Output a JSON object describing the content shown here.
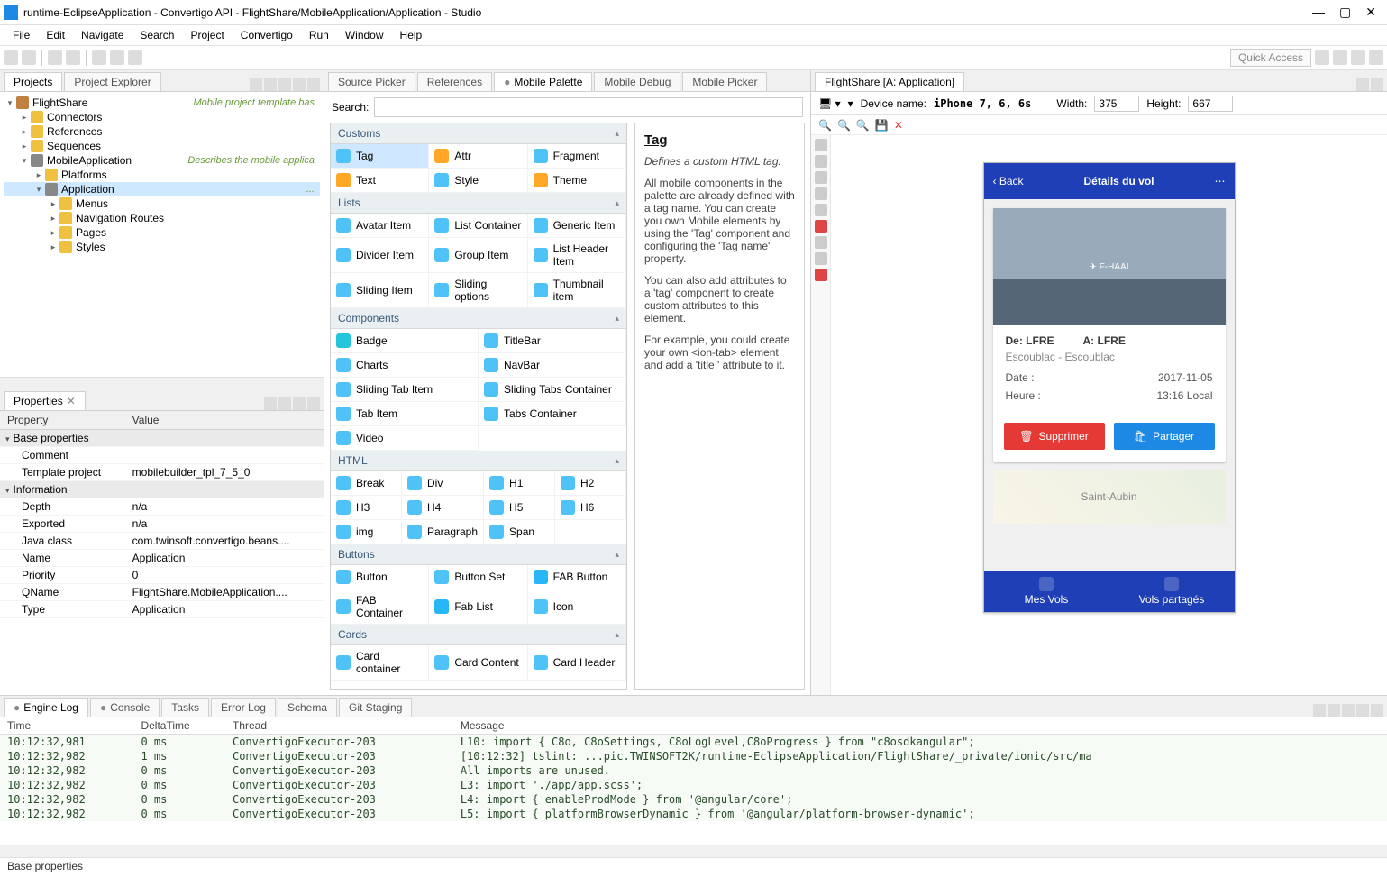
{
  "window": {
    "title": "runtime-EclipseApplication - Convertigo API - FlightShare/MobileApplication/Application - Studio"
  },
  "menubar": [
    "File",
    "Edit",
    "Navigate",
    "Search",
    "Project",
    "Convertigo",
    "Run",
    "Window",
    "Help"
  ],
  "quick_access": "Quick Access",
  "left": {
    "tabs": {
      "projects": "Projects",
      "explorer": "Project Explorer"
    },
    "tree": {
      "root": {
        "label": "FlightShare",
        "desc": "Mobile project template bas"
      },
      "connectors": "Connectors",
      "references": "References",
      "sequences": "Sequences",
      "mobileapp": {
        "label": "MobileApplication",
        "desc": "Describes the mobile applica"
      },
      "platforms": "Platforms",
      "application": "Application",
      "menus": "Menus",
      "navroutes": "Navigation Routes",
      "pages": "Pages",
      "styles": "Styles",
      "app_dots": "..."
    },
    "props": {
      "tab": "Properties",
      "cols": {
        "prop": "Property",
        "val": "Value"
      },
      "cat1": "Base properties",
      "comment": {
        "k": "Comment",
        "v": ""
      },
      "template": {
        "k": "Template project",
        "v": "mobilebuilder_tpl_7_5_0"
      },
      "cat2": "Information",
      "depth": {
        "k": "Depth",
        "v": "n/a"
      },
      "exported": {
        "k": "Exported",
        "v": "n/a"
      },
      "javaclass": {
        "k": "Java class",
        "v": "com.twinsoft.convertigo.beans...."
      },
      "name": {
        "k": "Name",
        "v": "Application"
      },
      "priority": {
        "k": "Priority",
        "v": "0"
      },
      "qname": {
        "k": "QName",
        "v": "FlightShare.MobileApplication...."
      },
      "type": {
        "k": "Type",
        "v": "Application"
      }
    }
  },
  "center": {
    "tabs": {
      "source": "Source Picker",
      "refs": "References",
      "palette": "Mobile Palette",
      "debug": "Mobile Debug",
      "picker": "Mobile Picker"
    },
    "search_label": "Search:",
    "groups": {
      "customs": {
        "hdr": "Customs",
        "items": [
          "Tag",
          "Attr",
          "Fragment",
          "Text",
          "Style",
          "Theme"
        ]
      },
      "lists": {
        "hdr": "Lists",
        "items": [
          "Avatar Item",
          "List Container",
          "Generic Item",
          "Divider Item",
          "Group Item",
          "List Header Item",
          "Sliding Item",
          "Sliding options",
          "Thumbnail item"
        ]
      },
      "components": {
        "hdr": "Components",
        "items": [
          "Badge",
          "TitleBar",
          "Charts",
          "NavBar",
          "Sliding Tab Item",
          "Sliding Tabs Container",
          "Tab Item",
          "Tabs Container",
          "Video"
        ]
      },
      "html": {
        "hdr": "HTML",
        "items": [
          "Break",
          "Div",
          "H1",
          "H2",
          "H3",
          "H4",
          "H5",
          "H6",
          "img",
          "Paragraph",
          "Span"
        ]
      },
      "buttons": {
        "hdr": "Buttons",
        "items": [
          "Button",
          "Button Set",
          "FAB Button",
          "FAB Container",
          "Fab List",
          "Icon"
        ]
      },
      "cards": {
        "hdr": "Cards",
        "items": [
          "Card container",
          "Card Content",
          "Card Header"
        ]
      }
    },
    "desc": {
      "title": "Tag",
      "p1": "Defines a custom HTML tag.",
      "p2": "All mobile components in the palette are already defined with a tag name. You can create you own Mobile elements by using the 'Tag' component and configuring the 'Tag name' property.",
      "p3": "You can also add attributes to a 'tag' component to create custom attributes to this element.",
      "p4": "For example, you could create your own <ion-tab> element and add a 'title ' attribute to it."
    }
  },
  "right": {
    "tab": "FlightShare [A: Application]",
    "devname_label": "Device name:",
    "devname": "iPhone 7, 6, 6s",
    "width_label": "Width:",
    "width": "375",
    "height_label": "Height:",
    "height": "667",
    "phone": {
      "back": "Back",
      "title": "Détails du vol",
      "from": "De: LFRE",
      "to": "A: LFRE",
      "sub": "Escoublac - Escoublac",
      "date_k": "Date :",
      "date_v": "2017-11-05",
      "time_k": "Heure :",
      "time_v": "13:16 Local",
      "delete": "Supprimer",
      "share": "Partager",
      "map_label": "Saint-Aubin",
      "nav1": "Mes Vols",
      "nav2": "Vols partagés"
    }
  },
  "bottom": {
    "tabs": {
      "engine": "Engine Log",
      "console": "Console",
      "tasks": "Tasks",
      "errlog": "Error Log",
      "schema": "Schema",
      "git": "Git Staging"
    },
    "cols": {
      "time": "Time",
      "delta": "DeltaTime",
      "thread": "Thread",
      "msg": "Message"
    },
    "rows": [
      {
        "t": "10:12:32,981",
        "d": " 0 ms",
        "th": "ConvertigoExecutor-203",
        "m": "    L10:  import { C8o, C8oSettings, C8oLogLevel,C8oProgress }       from \"c8osdkangular\";"
      },
      {
        "t": "10:12:32,982",
        "d": " 1 ms",
        "th": "ConvertigoExecutor-203",
        "m": "[10:12:32]  tslint: ...pic.TWINSOFT2K/runtime-EclipseApplication/FlightShare/_private/ionic/src/ma"
      },
      {
        "t": "10:12:32,982",
        "d": " 0 ms",
        "th": "ConvertigoExecutor-203",
        "m": "          All imports are unused."
      },
      {
        "t": "10:12:32,982",
        "d": " 0 ms",
        "th": "ConvertigoExecutor-203",
        "m": "     L3:  import './app/app.scss';"
      },
      {
        "t": "10:12:32,982",
        "d": " 0 ms",
        "th": "ConvertigoExecutor-203",
        "m": "     L4:  import { enableProdMode } from '@angular/core';"
      },
      {
        "t": "10:12:32,982",
        "d": " 0 ms",
        "th": "ConvertigoExecutor-203",
        "m": "     L5:  import { platformBrowserDynamic } from '@angular/platform-browser-dynamic';"
      }
    ]
  },
  "status": "Base properties"
}
